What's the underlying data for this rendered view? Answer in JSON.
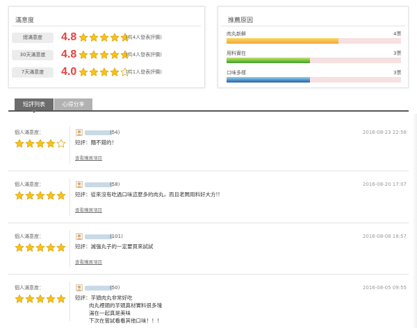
{
  "satisfaction": {
    "title": "滿意度",
    "rows": [
      {
        "label": "總滿意度",
        "score": "4.8",
        "rating": 4.8,
        "count": "(共4人發表評價)"
      },
      {
        "label": "30天滿意度",
        "score": "4.8",
        "rating": 4.8,
        "count": "(共4人發表評價)"
      },
      {
        "label": "7天滿意度",
        "score": "4.0",
        "rating": 4.0,
        "count": "(共1人發表評價)"
      }
    ]
  },
  "reasons": {
    "title": "推薦原因",
    "items": [
      {
        "label": "肉丸新鮮",
        "count": "4票",
        "fraction": 0.64,
        "color": "#f39c3a"
      },
      {
        "label": "用料實在",
        "count": "3票",
        "fraction": 0.48,
        "color": "#5cb82f"
      },
      {
        "label": "口味多樣",
        "count": "3票",
        "fraction": 0.48,
        "color": "#2f6fb5"
      }
    ]
  },
  "tabs": [
    {
      "label": "短評列表",
      "active": true
    },
    {
      "label": "心得分享",
      "active": false
    }
  ],
  "reviews": [
    {
      "label": "個人滿意度：",
      "rating": 4,
      "count": "(54)",
      "date": "2016-08-23 22:58",
      "lines": [
        {
          "key": "短評：",
          "text": "麵不錯的！"
        }
      ],
      "link": "查看購買項目"
    },
    {
      "label": "個人滿意度：",
      "rating": 5,
      "count": "(58)",
      "date": "2016-08-20 17:07",
      "lines": [
        {
          "key": "短評：",
          "text": "從來沒有吃過口味這麼多的肉丸，而且老闆用料好大方!!"
        }
      ],
      "link": "查看購買項目"
    },
    {
      "label": "個人滿意度：",
      "rating": 5,
      "count": "(101)",
      "date": "2016-08-08 18:57",
      "lines": [
        {
          "key": "短評：",
          "text": "滅強丸子的一定要買來試試"
        }
      ],
      "link": "查看購買項目"
    },
    {
      "label": "個人滿意度：",
      "rating": 5,
      "count": "(50)",
      "date": "2016-08-05 09:55",
      "lines": [
        {
          "key": "短評：",
          "text": "芋頭肉丸非常好吃"
        },
        {
          "key": "",
          "text": "肉丸裡頭的芋頭真材實料很多塊"
        },
        {
          "key": "",
          "text": "湯在一起真是美味"
        },
        {
          "key": "",
          "text": "下次在嘗試看看其他口味！！！"
        }
      ],
      "link": ""
    }
  ]
}
